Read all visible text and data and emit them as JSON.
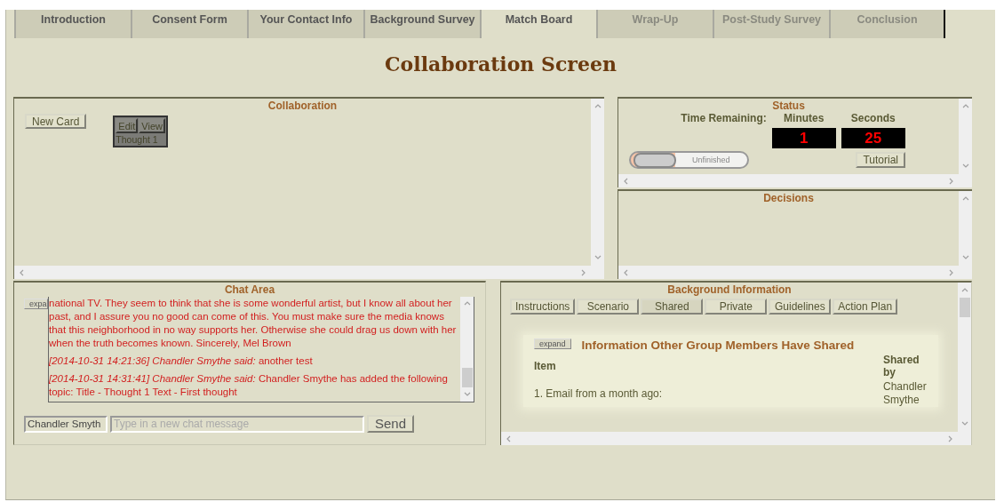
{
  "tabs": [
    {
      "label": "Introduction",
      "selected": false,
      "disabled": false
    },
    {
      "label": "Consent Form",
      "selected": false,
      "disabled": false
    },
    {
      "label": "Your Contact Info",
      "selected": false,
      "disabled": false
    },
    {
      "label": "Background Survey",
      "selected": false,
      "disabled": false
    },
    {
      "label": "Match Board",
      "selected": true,
      "disabled": false
    },
    {
      "label": "Wrap-Up",
      "selected": false,
      "disabled": true
    },
    {
      "label": "Post-Study Survey",
      "selected": false,
      "disabled": true
    },
    {
      "label": "Conclusion",
      "selected": false,
      "disabled": true
    }
  ],
  "title": "Collaboration Screen",
  "collaboration": {
    "title": "Collaboration",
    "new_card_button": "New Card",
    "cards": [
      {
        "edit_button": "Edit",
        "view_button": "View",
        "title": "Thought 1"
      }
    ]
  },
  "status": {
    "title": "Status",
    "time_label": "Time Remaining:",
    "minutes_label": "Minutes",
    "seconds_label": "Seconds",
    "minutes": "1",
    "seconds": "25",
    "toggle": {
      "label": "Unfinished",
      "on": false
    },
    "tutorial_button": "Tutorial"
  },
  "decisions": {
    "title": "Decisions"
  },
  "chat": {
    "title": "Chat Area",
    "expand_button": "expa",
    "messages": [
      {
        "text": "national TV. They seem to think that she is some wonderful artist, but I know all about her past, and I assure you no good can come of this. You must make sure the media knows that this neighborhood in no way supports her. Otherwise she could drag us down with her when the truth becomes known. Sincerely, Mel Brown"
      },
      {
        "text": "*[2014-10-31 14:21:36] Chandler Smythe said:* another test"
      },
      {
        "text": "*[2014-10-31 14:31:41] Chandler Smythe said:* Chandler Smythe has added the following topic: Title - Thought 1 Text - First thought"
      }
    ],
    "name_field": "Chandler Smyth",
    "message_field": {
      "placeholder": "Type in a new chat message"
    },
    "send_button": "Send"
  },
  "background_information": {
    "title": "Background Information",
    "tabs": [
      {
        "label": "Instructions",
        "selected": false
      },
      {
        "label": "Scenario",
        "selected": false
      },
      {
        "label": "Shared",
        "selected": true
      },
      {
        "label": "Private",
        "selected": false
      },
      {
        "label": "Guidelines",
        "selected": false
      },
      {
        "label": "Action Plan",
        "selected": false
      }
    ],
    "expand_button": "expand",
    "heading": "Information Other Group Members Have Shared",
    "table": {
      "columns": [
        "Item",
        "Shared by"
      ],
      "rows": [
        [
          "1. Email from a month ago:",
          "Chandler Smythe"
        ]
      ]
    }
  }
}
